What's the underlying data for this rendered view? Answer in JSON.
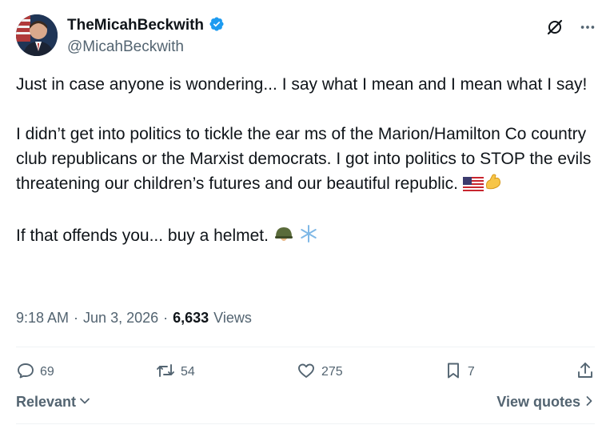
{
  "author": {
    "display_name": "TheMicahBeckwith",
    "handle": "@MicahBeckwith",
    "verified": true
  },
  "tweet": {
    "line1": "Just in case anyone is wondering... I say what I mean and I mean what I say!",
    "para2": "I didn’t get into politics to tickle the ear ms of the Marion/Hamilton Co country club republicans or the Marxist democrats. I got into politics to STOP the evils threatening our children’s futures and our beautiful republic.",
    "para3": "If that offends you... buy a helmet."
  },
  "meta": {
    "time": "9:18 AM",
    "date": "Jun 3, 2026",
    "views_count": "6,633",
    "views_label": "Views",
    "dot": "·"
  },
  "counts": {
    "replies": "69",
    "reposts": "54",
    "likes": "275",
    "bookmarks": "7"
  },
  "bottom": {
    "sort_label": "Relevant",
    "quotes_label": "View quotes"
  },
  "colors": {
    "text": "#0f1419",
    "muted": "#536471",
    "verified": "#1d9bf0"
  },
  "icons": [
    "verified-icon",
    "grok-icon",
    "more-icon",
    "reply-icon",
    "repost-icon",
    "like-icon",
    "bookmark-icon",
    "share-icon",
    "chevron-down-icon",
    "chevron-right-icon"
  ]
}
